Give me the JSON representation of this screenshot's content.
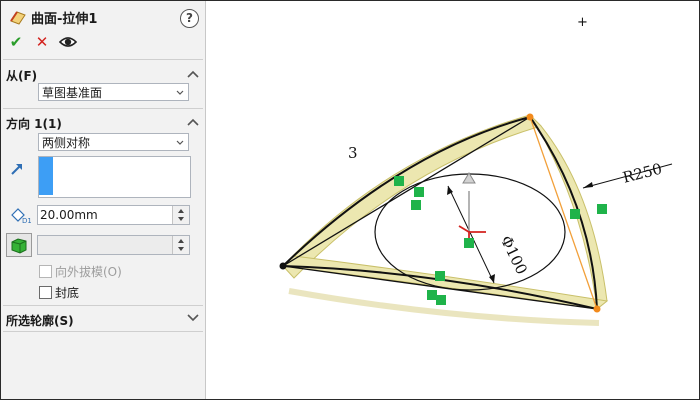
{
  "feature": {
    "title": "曲面-拉伸1"
  },
  "actions": {
    "ok": "✔",
    "cancel": "✕"
  },
  "from": {
    "title": "从(F)",
    "value": "草图基准面"
  },
  "direction": {
    "title": "方向 1(1)",
    "end_condition": "两侧对称",
    "depth": "20.00mm",
    "draft_value": "",
    "draft_outward_label": "向外拔模(O)",
    "draft_outward_checked": false,
    "cap_label": "封底",
    "cap_checked": false
  },
  "profiles": {
    "title": "所选轮廓(S)"
  },
  "sketch": {
    "dim_number": "3",
    "radius_label": "R250",
    "diameter_label": "Φ100",
    "cursor": "+"
  },
  "colors": {
    "surface_fill": "#ece7b0",
    "surface_edge": "#c9c06a",
    "relation_green": "#1fb34a",
    "endpoint_orange": "#f28a1c",
    "construction_orange": "#f2a03a",
    "selection_blue": "#3d9ef5"
  }
}
